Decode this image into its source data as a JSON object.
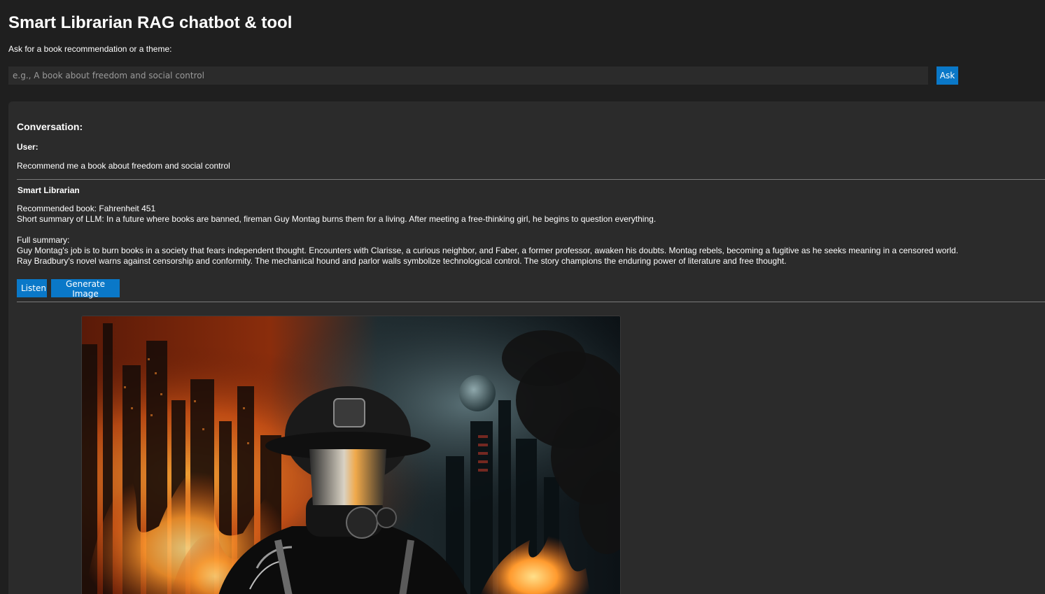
{
  "header": {
    "title": "Smart Librarian RAG chatbot & tool",
    "prompt_label": "Ask for a book recommendation or a theme:"
  },
  "search": {
    "placeholder": "e.g., A book about freedom and social control",
    "value": "",
    "ask_label": "Ask"
  },
  "conversation": {
    "heading": "Conversation:",
    "user_label": "User:",
    "user_message": "Recommend me a book about freedom and social control",
    "assistant_label": "Smart Librarian",
    "assistant_lines": {
      "recommended": "Recommended book: Fahrenheit 451",
      "short_summary": "Short summary of LLM: In a future where books are banned, fireman Guy Montag burns them for a living. After meeting a free-thinking girl, he begins to question everything.",
      "full_summary_label": "Full summary:",
      "full_summary_1": "Guy Montag's job is to burn books in a society that fears independent thought. Encounters with Clarisse, a curious neighbor, and Faber, a former professor, awaken his doubts. Montag rebels, becoming a fugitive as he seeks meaning in a censored world.",
      "full_summary_2": "Ray Bradbury's novel warns against censorship and conformity. The mechanical hound and parlor walls symbolize technological control. The story champions the enduring power of literature and free thought."
    },
    "actions": {
      "listen_label": "Listen",
      "generate_image_label": "Generate Image"
    }
  },
  "image": {
    "subject": "fireman-in-gas-mask-burning-city",
    "colors": {
      "fire": "#e8631a",
      "fire_core": "#ffb23a",
      "sky_dark": "#0f1a1f",
      "mist": "#5f7a80",
      "smoke": "#121212"
    }
  },
  "theme": {
    "background": "#1f1f1f",
    "panel": "#2b2b2b",
    "accent": "#0a78c8",
    "text": "#ffffff"
  }
}
